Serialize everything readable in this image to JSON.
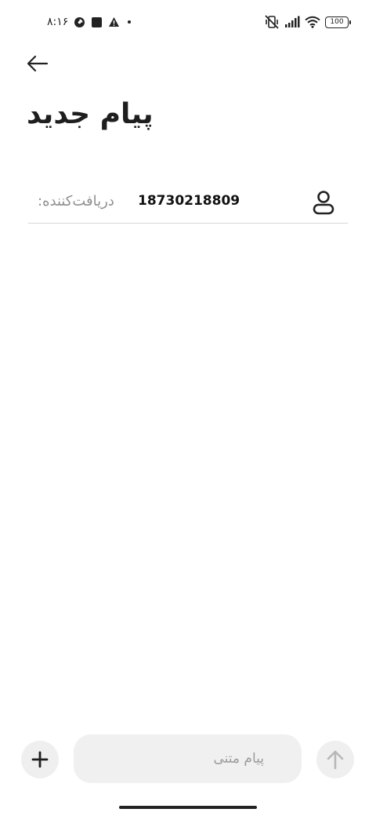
{
  "status_bar": {
    "time": "۸:۱۶",
    "battery": "100",
    "icons": [
      "data-saver-icon",
      "square-notification-icon",
      "warning-icon",
      "dot-icon",
      "vibrate-off-icon",
      "signal-icon",
      "wifi-icon",
      "battery-icon"
    ]
  },
  "header": {
    "back_icon": "arrow-left-icon",
    "title": "پیام جدید"
  },
  "recipient": {
    "label": "دریافت‌کننده:",
    "value": "18730218809",
    "icon": "contact-person-icon"
  },
  "compose": {
    "add_icon": "plus-icon",
    "placeholder": "پیام متنی",
    "value": "",
    "send_icon": "arrow-up-icon"
  },
  "colors": {
    "background": "#ffffff",
    "text": "#1b1b1b",
    "muted": "#8f8f8f",
    "button_bg": "#efefef",
    "input_bg": "#f0f0f0",
    "divider": "#d8d8d8"
  }
}
